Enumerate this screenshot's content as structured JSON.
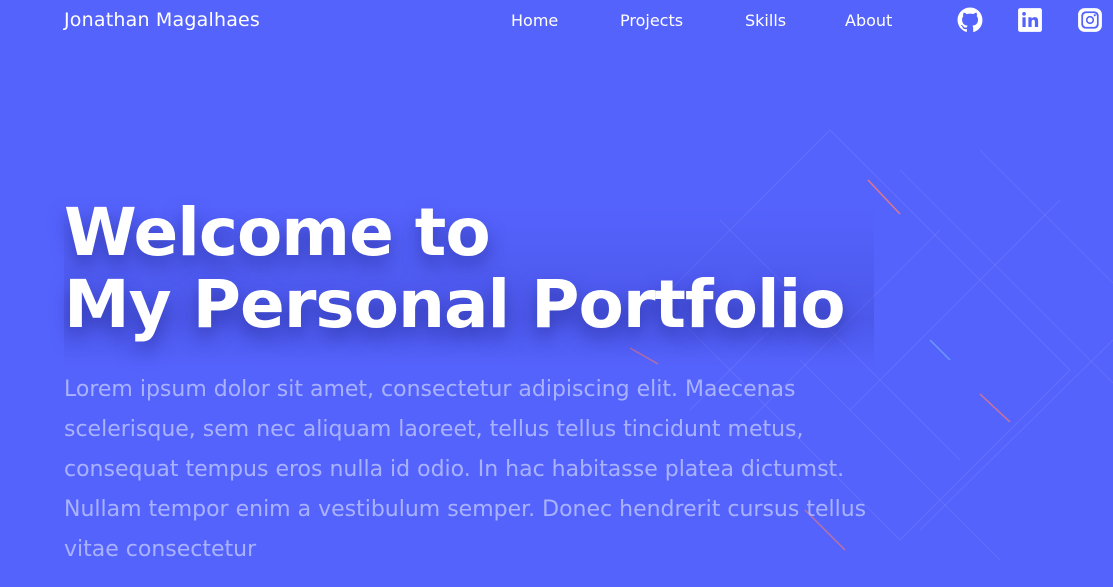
{
  "navbar": {
    "brand": "Jonathan Magalhaes",
    "links": [
      {
        "label": "Home"
      },
      {
        "label": "Projects"
      },
      {
        "label": "Skills"
      },
      {
        "label": "About"
      }
    ],
    "social": [
      {
        "icon": "github-icon"
      },
      {
        "icon": "linkedin-icon"
      },
      {
        "icon": "instagram-icon"
      }
    ]
  },
  "hero": {
    "title_line1": "Welcome to",
    "title_line2": "My Personal Portfolio",
    "description": "Lorem ipsum dolor sit amet, consectetur adipiscing elit. Maecenas scelerisque, sem nec aliquam laoreet, tellus tellus tincidunt metus, consequat tempus eros nulla id odio. In hac habitasse platea dictumst. Nullam tempor enim a vestibulum semper. Donec hendrerit cursus tellus vitae consectetur"
  },
  "colors": {
    "background": "#5563fd",
    "text": "#ffffff",
    "description": "#a9b2ff"
  }
}
